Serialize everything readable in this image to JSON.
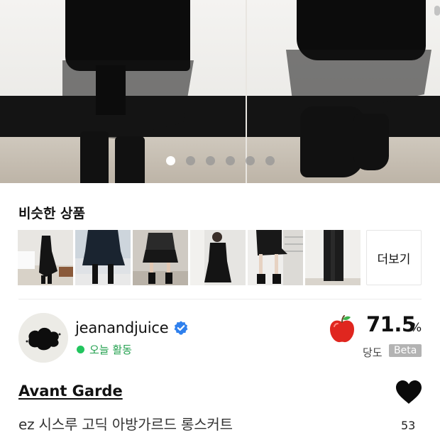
{
  "carousel": {
    "slide_count": 6,
    "active_index": 0
  },
  "similar": {
    "title": "비슷한 상품",
    "items": [
      {
        "image": "thumb-1"
      },
      {
        "image": "thumb-2"
      },
      {
        "image": "thumb-3"
      },
      {
        "image": "thumb-4"
      },
      {
        "image": "thumb-5"
      },
      {
        "image": "thumb-6"
      }
    ],
    "more_label": "더보기"
  },
  "seller": {
    "name": "jeanandjuice",
    "verified_icon": "verified-check-icon",
    "activity": "오늘 활동",
    "activity_color": "#22c55e"
  },
  "sweetness": {
    "icon": "apple-icon",
    "value": "71.5",
    "unit": "%",
    "label": "당도",
    "badge": "Beta"
  },
  "product": {
    "brand": "Avant Garde",
    "title": "ez 시스루 고딕 아방가르드 롱스커트",
    "like_icon": "heart-icon",
    "like_count": "53"
  }
}
